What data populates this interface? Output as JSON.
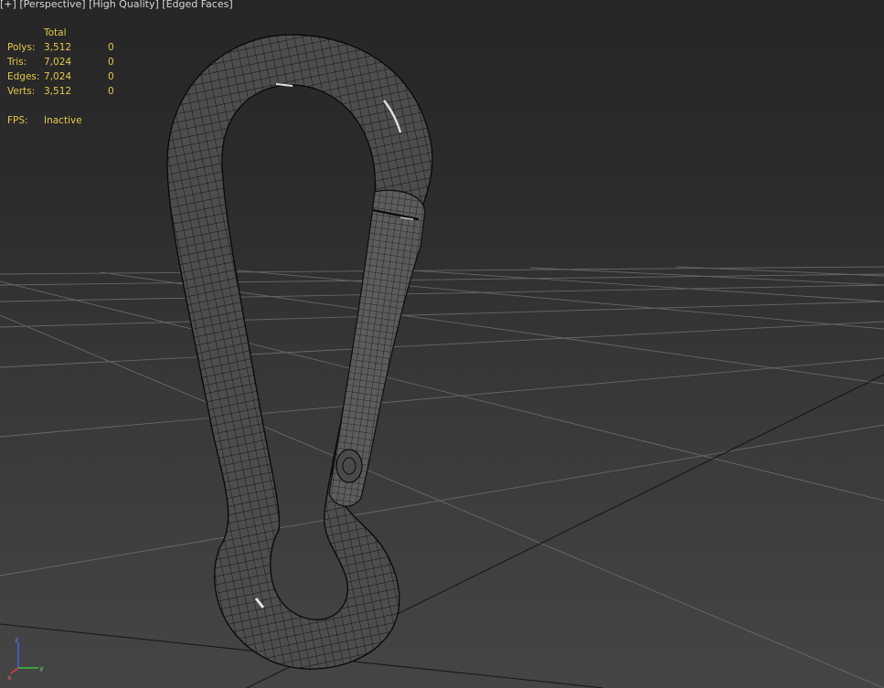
{
  "viewport": {
    "label_plus": "[+]",
    "label_view": "[Perspective]",
    "label_quality": "[High Quality]",
    "label_shading": "[Edged Faces]"
  },
  "stats": {
    "header": "Total",
    "rows": [
      {
        "label": "Polys:",
        "total": "3,512",
        "selected": "0"
      },
      {
        "label": "Tris:",
        "total": "7,024",
        "selected": "0"
      },
      {
        "label": "Edges:",
        "total": "7,024",
        "selected": "0"
      },
      {
        "label": "Verts:",
        "total": "3,512",
        "selected": "0"
      }
    ],
    "fps_label": "FPS:",
    "fps_value": "Inactive"
  },
  "gizmo": {
    "x": "x",
    "y": "y",
    "z": "z"
  },
  "colors": {
    "stats_text": "#e6c84a",
    "label_text": "#d8d8d8",
    "grid_line": "#6a6a6a",
    "mesh_fill": "#555555",
    "mesh_wire": "#111111",
    "axis_x": "#d04040",
    "axis_y": "#40c040",
    "axis_z": "#4060e0"
  },
  "icons": {
    "gizmo": "axis-tripod-icon"
  }
}
